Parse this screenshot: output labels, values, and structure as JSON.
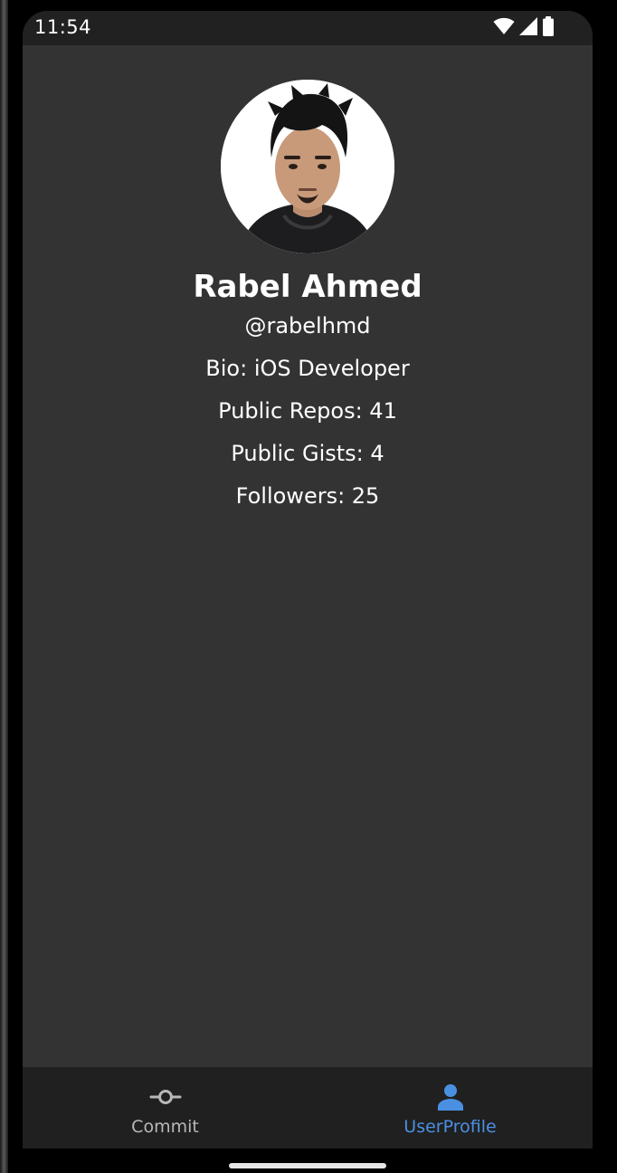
{
  "status_bar": {
    "time": "11:54",
    "icons": [
      "wifi-icon",
      "signal-icon",
      "battery-icon"
    ]
  },
  "profile": {
    "avatar_alt": "profile photo",
    "name": "Rabel Ahmed",
    "handle": "@rabelhmd",
    "bio": "Bio: iOS Developer",
    "public_repos": "Public Repos: 41",
    "public_gists": "Public Gists: 4",
    "followers": "Followers: 25"
  },
  "bottom_nav": {
    "items": [
      {
        "label": "Commit",
        "icon": "commit-icon",
        "active": false
      },
      {
        "label": "UserProfile",
        "icon": "person-icon",
        "active": true
      }
    ]
  },
  "colors": {
    "background": "#333333",
    "status_bar": "#212121",
    "nav_bar": "#202020",
    "accent": "#4a90e2",
    "inactive": "#b8b8b8"
  }
}
